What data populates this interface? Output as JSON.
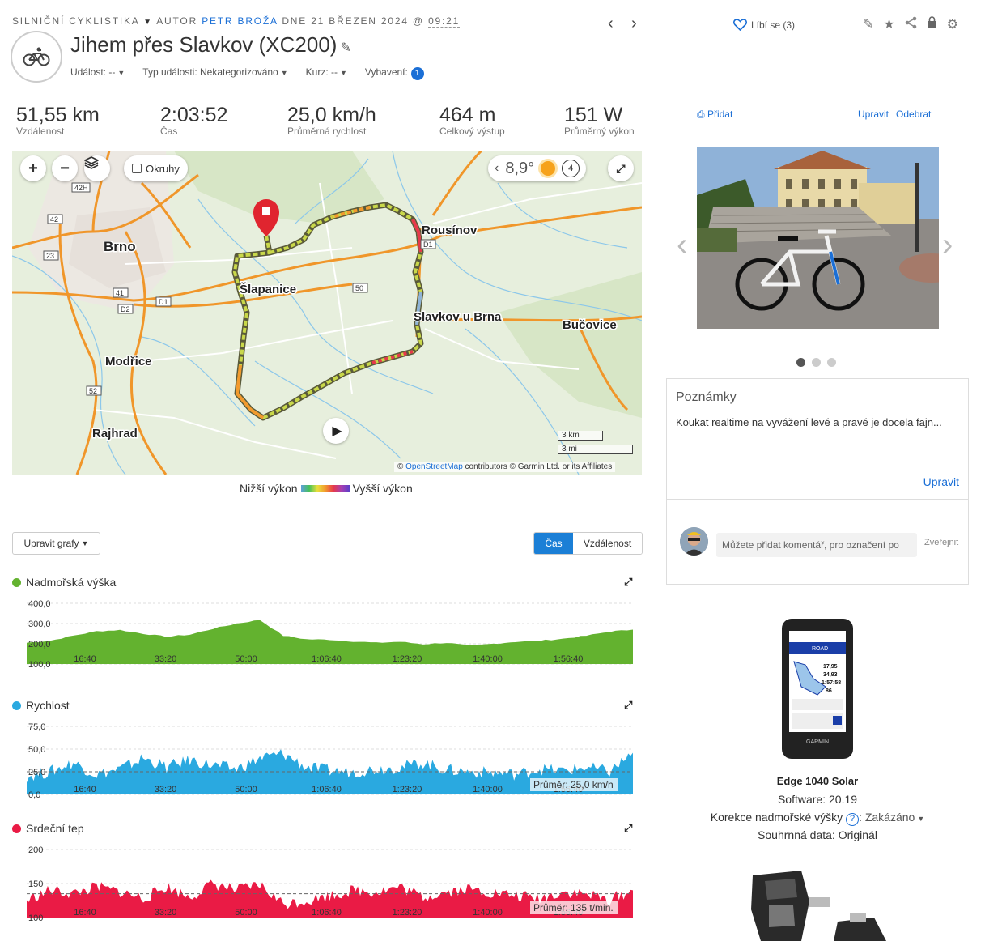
{
  "header": {
    "activity_type": "SILNIČNÍ CYKLISTIKA",
    "author_prefix": "AUTOR",
    "author": "PETR BROŽA",
    "date_prefix": "DNE 21 BŘEZEN 2024 @",
    "time": "09:21",
    "title": "Jihem přes Slavkov (XC200)",
    "event_label": "Událost: --",
    "event_type_label": "Typ události: Nekategorizováno",
    "course_label": "Kurz: --",
    "gear_label": "Vybavení:",
    "gear_count": "1",
    "like_label": "Líbí se (3)"
  },
  "stats": [
    {
      "value": "51,55 km",
      "label": "Vzdálenost"
    },
    {
      "value": "2:03:52",
      "label": "Čas"
    },
    {
      "value": "25,0 km/h",
      "label": "Průměrná rychlost"
    },
    {
      "value": "464 m",
      "label": "Celkový výstup"
    },
    {
      "value": "151 W",
      "label": "Průměrný výkon"
    }
  ],
  "map": {
    "layers_label": "Okruhy",
    "temperature": "8,9°",
    "timer_value": "4",
    "scale_km": "3 km",
    "scale_mi": "3 mi",
    "attribution_link": "OpenStreetMap",
    "attribution_rest": "contributors © Garmin Ltd. or its Affiliates",
    "places": {
      "brno": "Brno",
      "slapanice": "Šlapanice",
      "rousinov": "Rousínov",
      "slavkov": "Slavkov u Brna",
      "bucovice": "Bučovice",
      "modrice": "Modřice",
      "rajhrad": "Rajhrad"
    },
    "road_labels": {
      "r42h": "42H",
      "r42": "42",
      "r23": "23",
      "r41": "41",
      "d2": "D2",
      "d1a": "D1",
      "d1b": "D1",
      "r50": "50",
      "r52": "52"
    },
    "legend_low": "Nižší výkon",
    "legend_high": "Vyšší výkon"
  },
  "graph_controls": {
    "edit_label": "Upravit grafy",
    "tab_time": "Čas",
    "tab_distance": "Vzdálenost"
  },
  "charts": {
    "elevation": {
      "title": "Nadmořská výška",
      "color": "#63b22f"
    },
    "speed": {
      "title": "Rychlost",
      "color": "#2aa9e0",
      "avg_label": "Průměr: 25,0 km/h"
    },
    "heart": {
      "title": "Srdeční tep",
      "color": "#ea1b45",
      "avg_label": "Průměr: 135 t/min."
    }
  },
  "chart_data": [
    {
      "type": "area",
      "title": "Nadmořská výška",
      "x": [
        "16:40",
        "33:20",
        "50:00",
        "1:06:40",
        "1:23:20",
        "1:40:00",
        "1:56:40"
      ],
      "yticks": [
        "400,0",
        "300,0",
        "200,0",
        "100,0"
      ],
      "ylim": [
        100,
        400
      ],
      "series": [
        {
          "values": [
            205,
            215,
            240,
            262,
            268,
            250,
            235,
            245,
            275,
            300,
            318,
            240,
            222,
            220,
            212,
            205,
            210,
            198,
            205,
            190,
            200,
            210,
            215,
            225,
            240,
            260,
            270
          ]
        }
      ]
    },
    {
      "type": "area",
      "title": "Rychlost",
      "x": [
        "16:40",
        "33:20",
        "50:00",
        "1:06:40",
        "1:23:20",
        "1:40:00",
        "1:56:40"
      ],
      "yticks": [
        "75,0",
        "50,0",
        "25,0",
        "0,0"
      ],
      "ylim": [
        0,
        75
      ],
      "series": [
        {
          "values": [
            20,
            25,
            35,
            22,
            28,
            40,
            30,
            38,
            32,
            28,
            40,
            45,
            30,
            26,
            25,
            28,
            30,
            35,
            27,
            25,
            24,
            22,
            28,
            26,
            30,
            25,
            46
          ]
        }
      ]
    },
    {
      "type": "area",
      "title": "Srdeční tep",
      "x": [
        "16:40",
        "33:20",
        "50:00",
        "1:06:40",
        "1:23:20",
        "1:40:00",
        "1:56:40"
      ],
      "yticks": [
        "200",
        "150",
        "100"
      ],
      "ylim": [
        100,
        200
      ],
      "series": [
        {
          "values": [
            125,
            140,
            135,
            145,
            138,
            128,
            145,
            130,
            150,
            140,
            148,
            120,
            125,
            132,
            140,
            138,
            145,
            130,
            138,
            142,
            136,
            132,
            128,
            138,
            134,
            126,
            140
          ]
        }
      ]
    }
  ],
  "photos": {
    "add_label": "Přidat",
    "edit_label": "Upravit",
    "remove_label": "Odebrat"
  },
  "notes": {
    "title": "Poznámky",
    "text": "Koukat realtime na vyvážení levé a pravé je docela fajn...",
    "edit_label": "Upravit"
  },
  "comments": {
    "placeholder": "Můžete přidat komentář, pro označení po",
    "publish_label": "Zveřejnit"
  },
  "device": {
    "name": "Edge 1040 Solar",
    "software": "Software: 20.19",
    "elevation_correction_label": "Korekce nadmořské výšky",
    "elevation_correction_value": "Zakázáno",
    "summary": "Souhrnná data: Originál",
    "screen_title": "ROAD",
    "screen_values": [
      "17,95",
      "34,93",
      "1:57:58",
      "86"
    ],
    "screen_brand": "GARMIN"
  }
}
